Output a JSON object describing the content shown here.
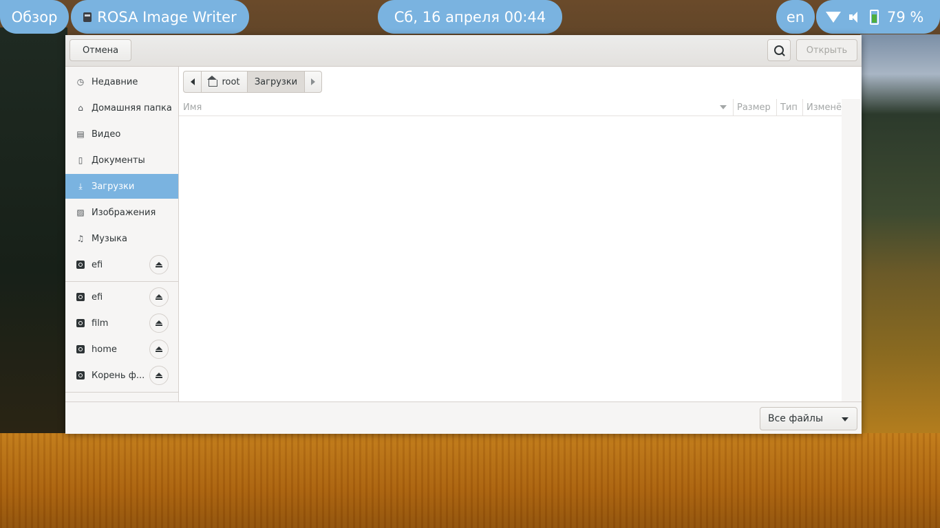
{
  "topbar": {
    "overview": "Обзор",
    "app_name": "ROSA Image Writer",
    "clock": "Сб, 16 апреля  00:44",
    "language": "en",
    "battery": "79 %",
    "battery_level": 0.79
  },
  "dialog": {
    "cancel": "Отмена",
    "open": "Открыть",
    "sidebar": {
      "places": [
        {
          "label": "Недавние",
          "icon": "recent-icon"
        },
        {
          "label": "Домашняя папка",
          "icon": "home-icon"
        },
        {
          "label": "Видео",
          "icon": "video-icon"
        },
        {
          "label": "Документы",
          "icon": "documents-icon"
        },
        {
          "label": "Загрузки",
          "icon": "download-icon",
          "selected": true
        },
        {
          "label": "Изображения",
          "icon": "pictures-icon"
        },
        {
          "label": "Музыка",
          "icon": "music-icon"
        },
        {
          "label": "efi",
          "icon": "drive-icon"
        }
      ],
      "devices": [
        {
          "label": "efi",
          "icon": "drive-icon"
        },
        {
          "label": "film",
          "icon": "drive-icon"
        },
        {
          "label": "home",
          "icon": "drive-icon"
        },
        {
          "label": "Корень ф...",
          "icon": "drive-icon"
        }
      ]
    },
    "pathbar": {
      "segments": [
        "root",
        "Загрузки"
      ]
    },
    "columns": {
      "name": "Имя",
      "size": "Размер",
      "type": "Тип",
      "modified": "Изменён"
    },
    "filter": "Все файлы"
  },
  "colors": {
    "accent": "#7ab3e0",
    "window_bg": "#f6f5f4",
    "text": "#2e3436"
  }
}
